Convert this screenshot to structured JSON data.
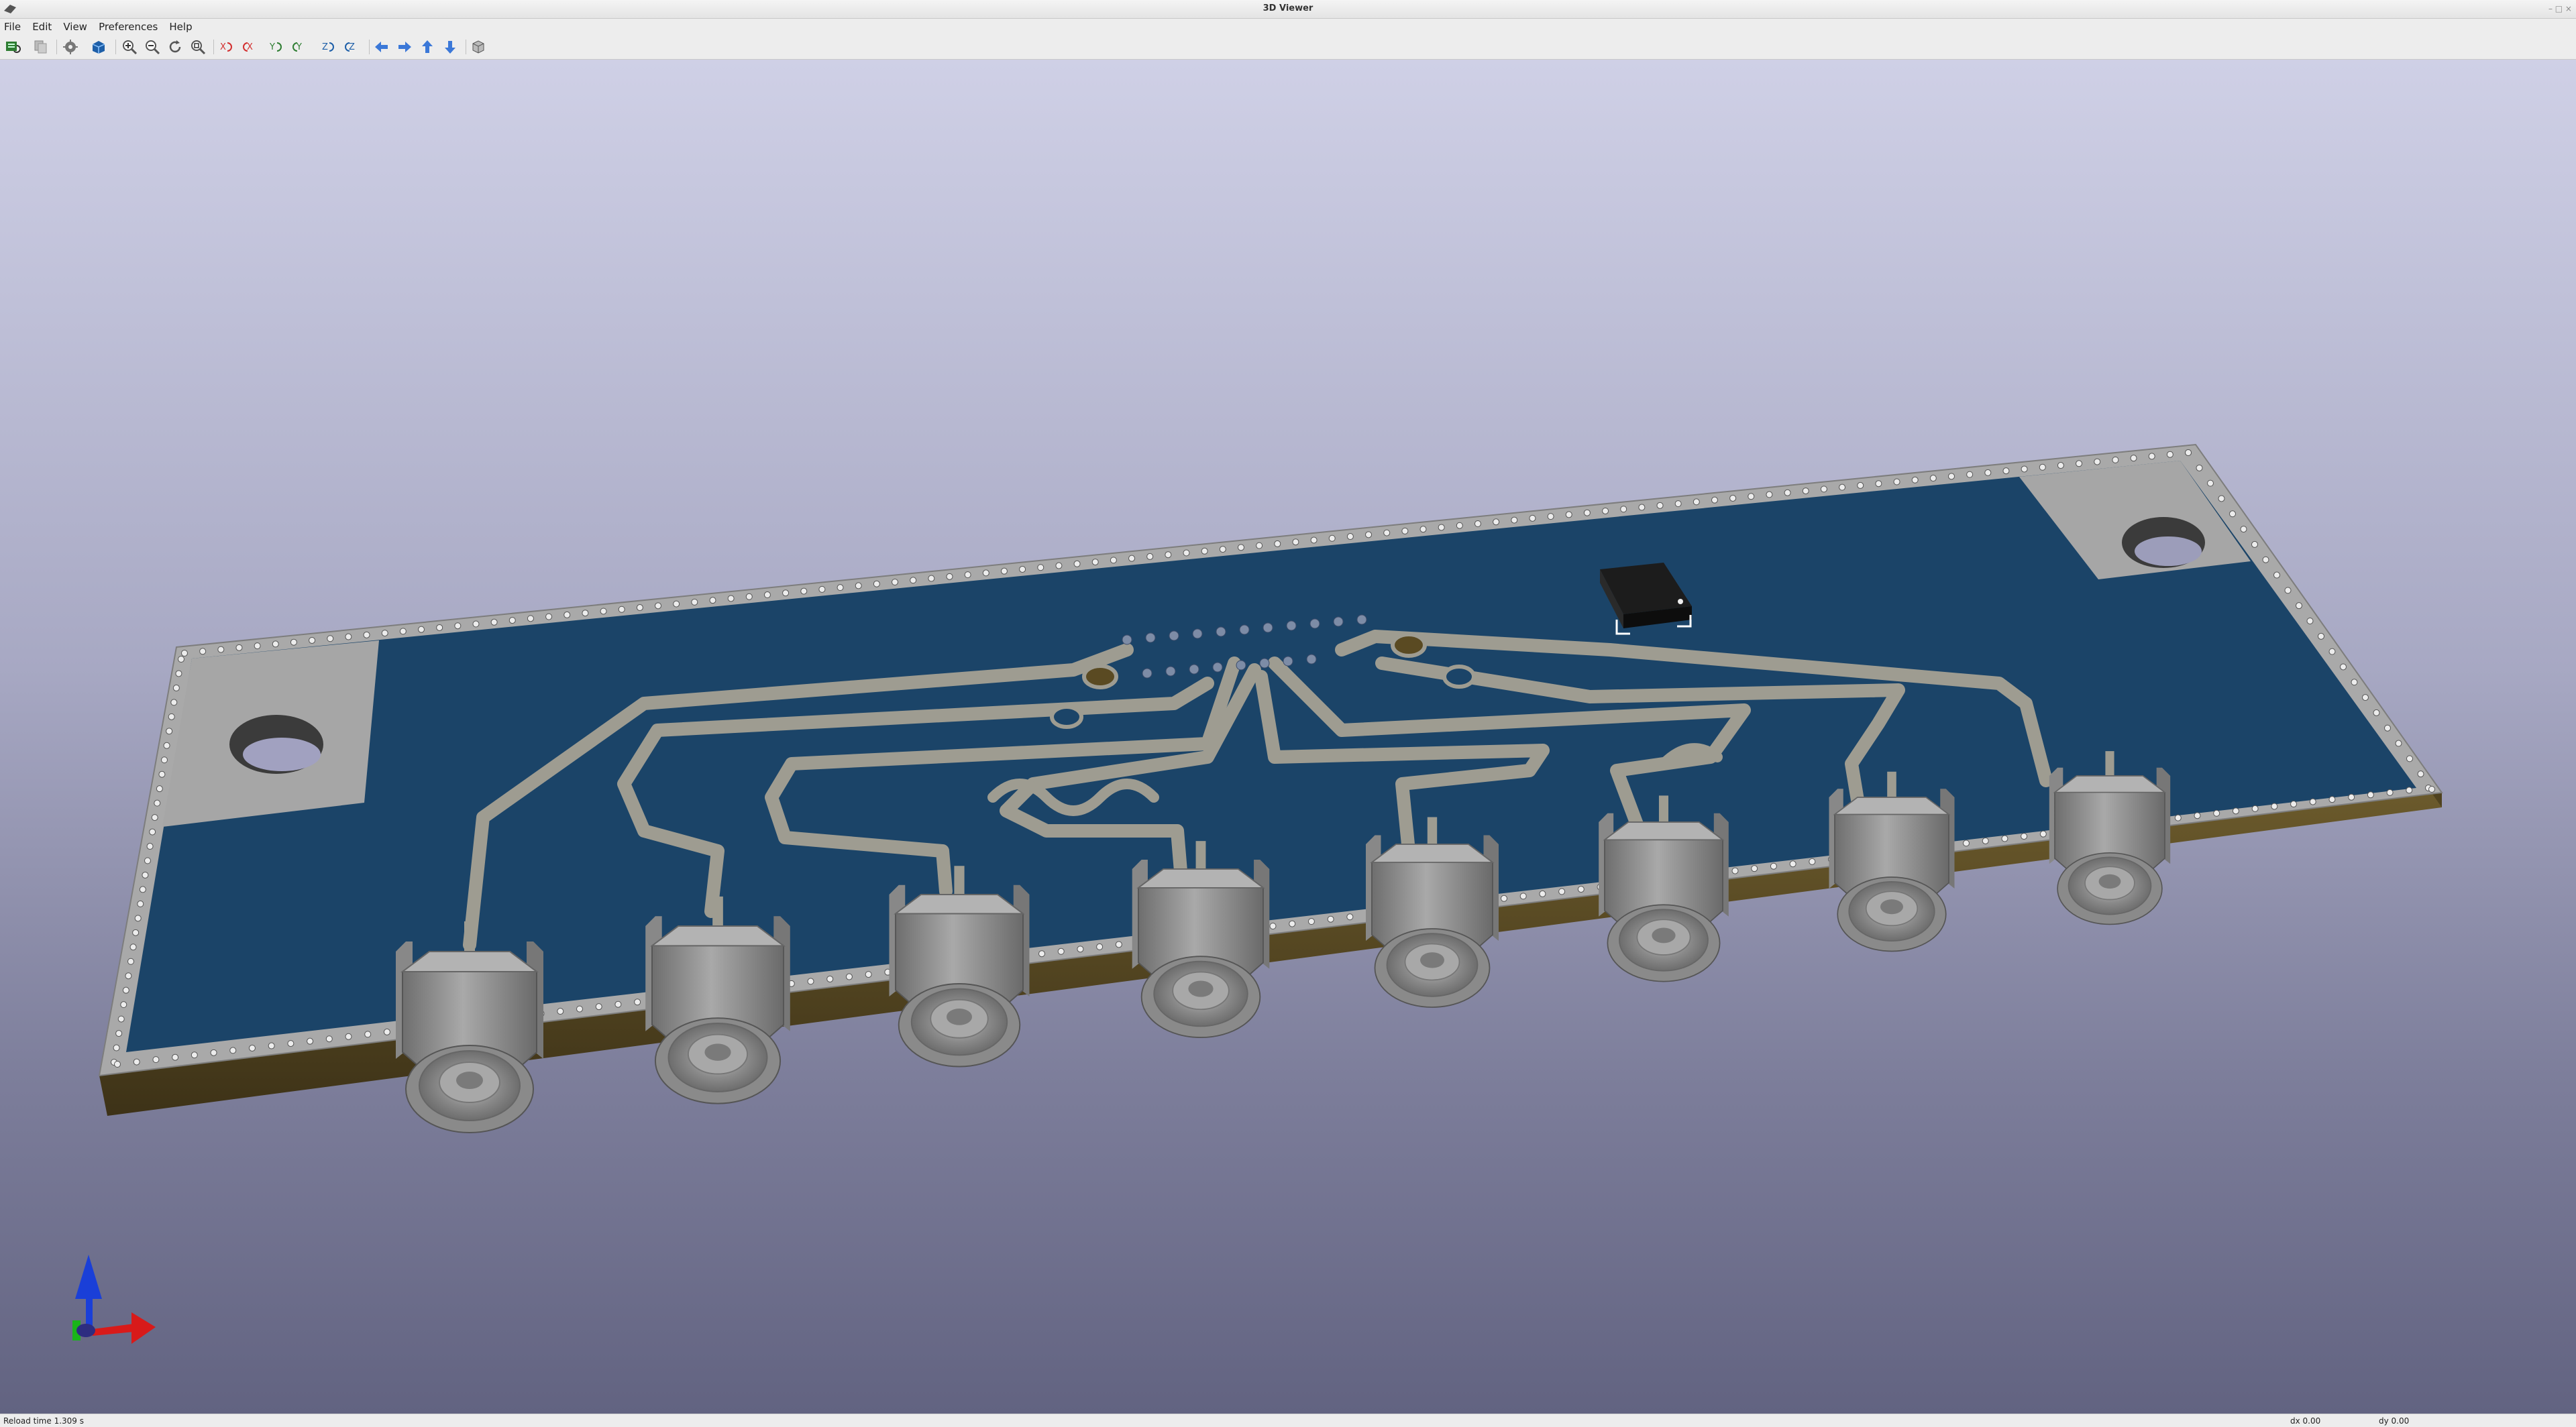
{
  "window": {
    "title": "3D Viewer"
  },
  "menu": {
    "items": [
      "File",
      "Edit",
      "View",
      "Preferences",
      "Help"
    ]
  },
  "toolbar": {
    "buttons": [
      {
        "name": "reload-board-icon"
      },
      {
        "name": "copy-image-icon"
      },
      {
        "name": "render-options-icon"
      },
      {
        "name": "raytrace-icon"
      },
      {
        "name": "zoom-in-icon"
      },
      {
        "name": "zoom-out-icon"
      },
      {
        "name": "refresh-icon"
      },
      {
        "name": "zoom-fit-icon"
      },
      {
        "name": "rotate-x-cw-icon"
      },
      {
        "name": "rotate-x-ccw-icon"
      },
      {
        "name": "rotate-y-cw-icon"
      },
      {
        "name": "rotate-y-ccw-icon"
      },
      {
        "name": "rotate-z-cw-icon"
      },
      {
        "name": "rotate-z-ccw-icon"
      },
      {
        "name": "move-left-icon"
      },
      {
        "name": "move-right-icon"
      },
      {
        "name": "move-up-icon"
      },
      {
        "name": "move-down-icon"
      },
      {
        "name": "orthographic-toggle-icon"
      }
    ]
  },
  "status": {
    "reload": "Reload time 1.309 s",
    "dx": "dx 0.00",
    "dy": "dy 0.00"
  },
  "colors": {
    "board_mask": "#1b4468",
    "copper_trace": "#9e9c91",
    "board_edge": "#5a4a22",
    "connector_body": "#8d8d8d",
    "chip": "#1c1c1c",
    "axis_z": "#1a3fd8",
    "axis_x": "#d81a1a",
    "axis_y": "#1ab41a"
  }
}
